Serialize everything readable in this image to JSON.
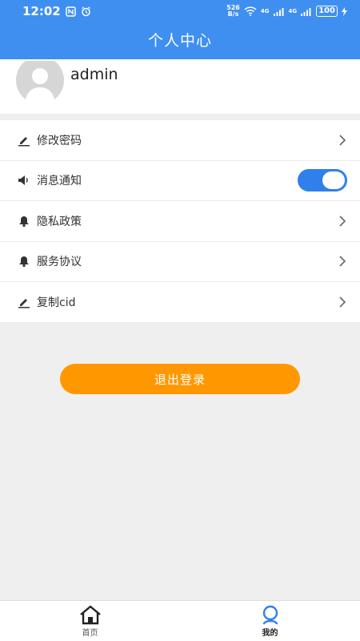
{
  "status_bar": {
    "time": "12:02",
    "net_speed_value": "526",
    "net_speed_unit": "B/s",
    "battery": "100",
    "signal1_label": "4G",
    "signal2_label": "4G"
  },
  "header": {
    "title": "个人中心"
  },
  "profile": {
    "username": "admin"
  },
  "menu": {
    "items": [
      {
        "label": "修改密码",
        "icon": "pencil-icon"
      },
      {
        "label": "消息通知",
        "icon": "speaker-icon",
        "toggle_on": true
      },
      {
        "label": "隐私政策",
        "icon": "bell-icon"
      },
      {
        "label": "服务协议",
        "icon": "bell-icon"
      },
      {
        "label": "复制cid",
        "icon": "pencil-icon"
      }
    ]
  },
  "logout": {
    "label": "退出登录"
  },
  "tabbar": {
    "tabs": [
      {
        "label": "首页",
        "icon": "home-icon"
      },
      {
        "label": "我的",
        "icon": "user-icon",
        "active": true
      }
    ]
  },
  "colors": {
    "header": "#3f8ff0",
    "toggle": "#2f80ed",
    "logout": "#ff9800",
    "active_tab_icon": "#2f80ed"
  }
}
